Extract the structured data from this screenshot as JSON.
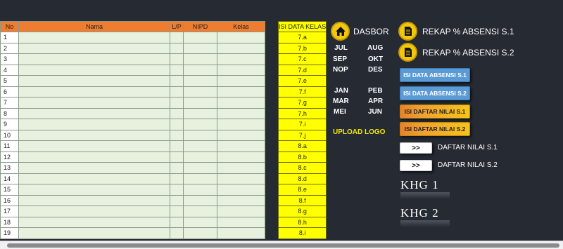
{
  "grid": {
    "headers": [
      "No",
      "Nama",
      "L/P",
      "NIPD",
      "Kelas"
    ],
    "rows": [
      "1",
      "2",
      "3",
      "4",
      "5",
      "6",
      "7",
      "8",
      "9",
      "10",
      "11",
      "12",
      "13",
      "14",
      "15",
      "16",
      "17",
      "18",
      "19"
    ]
  },
  "class_column": {
    "header": "ISI DATA KELAS",
    "values": [
      "7.a",
      "7.b",
      "7.c",
      "7.d",
      "7.e",
      "7.f",
      "7.g",
      "7.h",
      "7.i",
      "7.j",
      "8.a",
      "8.b",
      "8.c",
      "8.d",
      "8.e",
      "8.f",
      "8.g",
      "8.h",
      "8.i"
    ]
  },
  "dasbor": {
    "label": "DASBOR"
  },
  "months": {
    "jul": "JUL",
    "aug": "AUG",
    "sep": "SEP",
    "okt": "OKT",
    "nop": "NOP",
    "des": "DES",
    "jan": "JAN",
    "peb": "PEB",
    "mar": "MAR",
    "apr": "APR",
    "mei": "MEI",
    "jun": "JUN"
  },
  "upload_logo": "UPLOAD LOGO",
  "rekap": {
    "s1": "REKAP % ABSENSI S.1",
    "s2": "REKAP % ABSENSI S.2"
  },
  "buttons": {
    "absensi_s1": "ISI DATA ABSENSI S.1",
    "absensi_s2": "ISI DATA ABSENSI S.2",
    "nilai_s1": "ISI DAFTAR NILAI S.1",
    "nilai_s2": "ISI DAFTAR NILAI S.2",
    "arrow": ">>"
  },
  "daftar": {
    "s1": "DAFTAR NILAI S.1",
    "s2": "DAFTAR NILAI S.2"
  },
  "khg": {
    "k1": "KHG 1",
    "k2": "KHG 2"
  },
  "colors": {
    "header_orange": "#ef7d31",
    "class_yellow": "#ffff00",
    "panel_bg": "#252a33",
    "btn_blue": "#5b9bd5",
    "upload_yellow": "#f5e800"
  }
}
